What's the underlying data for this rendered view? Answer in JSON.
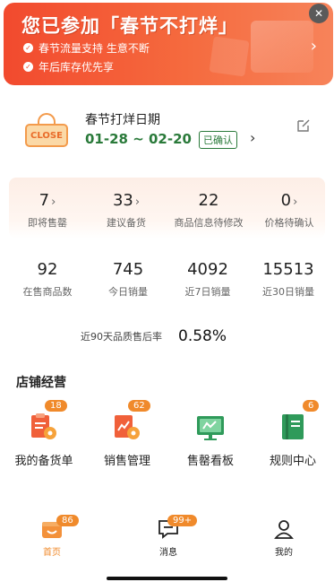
{
  "banner": {
    "title": "您已参加「春节不打烊」",
    "lines": [
      "春节流量支持 生意不断",
      "年后库存优先享"
    ]
  },
  "holiday": {
    "sign_text": "CLOSE",
    "title": "春节打烊日期",
    "dates": "01-28 ~ 02-20",
    "status": "已确认"
  },
  "stats_top": [
    {
      "value": "7",
      "label": "即将售罄",
      "has_arrow": true
    },
    {
      "value": "33",
      "label": "建议备货",
      "has_arrow": true
    },
    {
      "value": "22",
      "label": "商品信息待修改",
      "has_arrow": false
    },
    {
      "value": "0",
      "label": "价格待确认",
      "has_arrow": true
    }
  ],
  "stats_bottom": [
    {
      "value": "92",
      "label": "在售商品数"
    },
    {
      "value": "745",
      "label": "今日销量"
    },
    {
      "value": "4092",
      "label": "近7日销量"
    },
    {
      "value": "15513",
      "label": "近30日销量"
    }
  ],
  "quality": {
    "label": "近90天品质售后率",
    "value": "0.58%"
  },
  "store": {
    "title": "店铺经营",
    "tools": [
      {
        "label": "我的备货单",
        "badge": "18",
        "icon": "stock-order-icon"
      },
      {
        "label": "销售管理",
        "badge": "62",
        "icon": "sales-management-icon"
      },
      {
        "label": "售罄看板",
        "badge": "",
        "icon": "soldout-board-icon"
      },
      {
        "label": "规则中心",
        "badge": "6",
        "icon": "rules-book-icon"
      }
    ]
  },
  "tabs": [
    {
      "label": "首页",
      "badge": "86",
      "icon": "home-shop-icon",
      "active": true
    },
    {
      "label": "消息",
      "badge": "99+",
      "icon": "message-icon",
      "active": false
    },
    {
      "label": "我的",
      "badge": "",
      "icon": "user-icon",
      "active": false
    }
  ],
  "colors": {
    "accent": "#f08a2b",
    "banner": "#f24a2e",
    "green": "#2a7a3a"
  },
  "chevron": "›",
  "close_glyph": "✕"
}
